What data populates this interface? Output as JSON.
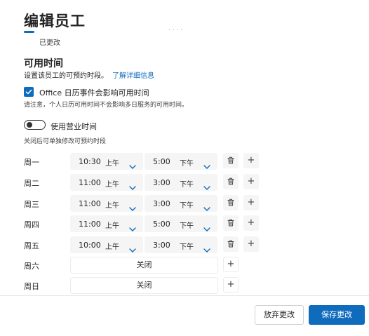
{
  "header": {
    "title": "编辑员工",
    "status": "已更改",
    "ghost_text": "·  ·  ·  ·"
  },
  "availability": {
    "title": "可用时间",
    "description": "设置该员工的可预约时段。",
    "learn_more": "了解详细信息",
    "office_checkbox_label": "Office 日历事件会影响可用时间",
    "office_checkbox_checked": true,
    "note": "请注意，个人日历可用时间不会影响多日服务的可用时间。",
    "business_hours_toggle_label": "使用营业时间",
    "business_hours_toggle_on": false,
    "toggle_note": "关闭后可单独修改可预约时段"
  },
  "days": [
    {
      "label": "周一",
      "closed": false,
      "start": "10:30",
      "start_ampm": "上午",
      "end": "5:00",
      "end_ampm": "下午"
    },
    {
      "label": "周二",
      "closed": false,
      "start": "11:00",
      "start_ampm": "上午",
      "end": "3:00",
      "end_ampm": "下午"
    },
    {
      "label": "周三",
      "closed": false,
      "start": "11:00",
      "start_ampm": "上午",
      "end": "3:00",
      "end_ampm": "下午"
    },
    {
      "label": "周四",
      "closed": false,
      "start": "11:00",
      "start_ampm": "上午",
      "end": "5:00",
      "end_ampm": "下午"
    },
    {
      "label": "周五",
      "closed": false,
      "start": "10:00",
      "start_ampm": "上午",
      "end": "3:00",
      "end_ampm": "下午"
    },
    {
      "label": "周六",
      "closed": true,
      "closed_label": "关闭"
    },
    {
      "label": "周日",
      "closed": true,
      "closed_label": "关闭"
    }
  ],
  "icons": {
    "delete": "trash-icon",
    "add": "+",
    "chevron": "chevron-down-icon"
  },
  "footer": {
    "discard_label": "放弃更改",
    "save_label": "保存更改"
  },
  "colors": {
    "accent": "#0f6cbd"
  }
}
